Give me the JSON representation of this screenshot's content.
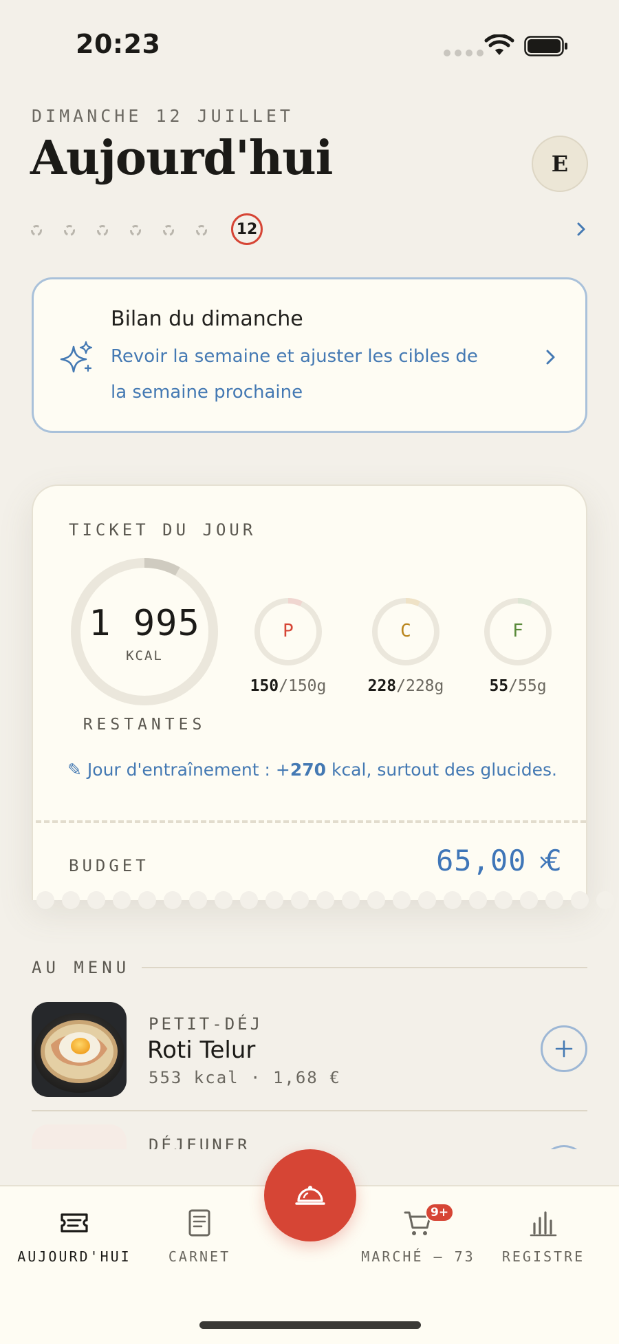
{
  "status_bar": {
    "time": "20:23"
  },
  "header": {
    "date": "DIMANCHE 12 JUILLET",
    "title": "Aujourd'hui",
    "avatar_initial": "E"
  },
  "week": {
    "current_day": "12"
  },
  "review_card": {
    "title": "Bilan du dimanche",
    "subtitle": "Revoir la semaine et ajuster les cibles de la semaine prochaine"
  },
  "ticket": {
    "label": "TICKET DU JOUR",
    "kcal_value": "1 995",
    "kcal_unit": "KCAL",
    "kcal_caption": "RESTANTES",
    "kcal_consumed_fraction": 0.08,
    "macros": [
      {
        "letter": "P",
        "remaining": "150",
        "total": "/150g",
        "color": "#d64535",
        "track_color": "#f0d6d0",
        "consumed_fraction": 0.07
      },
      {
        "letter": "C",
        "remaining": "228",
        "total": "/228g",
        "color": "#b9851c",
        "track_color": "#efe2c6",
        "consumed_fraction": 0.07
      },
      {
        "letter": "F",
        "remaining": "55",
        "total": "/55g",
        "color": "#5a8a3a",
        "track_color": "#dfe6d5",
        "consumed_fraction": 0.07
      }
    ],
    "training_note_prefix": "✎ Jour d'entraînement : +",
    "training_note_value": "270",
    "training_note_suffix": " kcal, surtout des glucides.",
    "budget_label": "BUDGET",
    "budget_value": "65,00 €"
  },
  "menu": {
    "header": "AU MENU",
    "meals": [
      {
        "type": "PETIT-DÉJ",
        "name": "Roti Telur",
        "meta": "553 kcal · 1,68 €"
      },
      {
        "type": "DÉJEUNER"
      }
    ]
  },
  "tabs": [
    {
      "label": "AUJOURD'HUI",
      "icon": "ticket-icon"
    },
    {
      "label": "CARNET",
      "icon": "notebook-icon"
    },
    {
      "label": "MARCHÉ — 73",
      "icon": "cart-icon",
      "badge": "9+"
    },
    {
      "label": "REGISTRE",
      "icon": "bar-chart-icon"
    }
  ],
  "colors": {
    "accent_red": "#d64535",
    "accent_blue": "#3f76b8",
    "background": "#f3f0e9",
    "card": "#fefcf3"
  }
}
